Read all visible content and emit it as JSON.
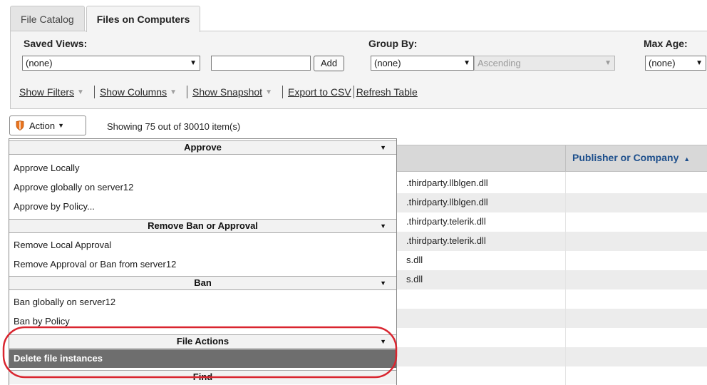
{
  "tabs": [
    {
      "label": "File Catalog",
      "active": false
    },
    {
      "label": "Files on Computers",
      "active": true
    }
  ],
  "filters": {
    "saved_views_label": "Saved Views:",
    "saved_views_value": "(none)",
    "view_name_value": "",
    "add_label": "Add",
    "group_by_label": "Group By:",
    "group_by_value": "(none)",
    "sort_order_value": "Ascending",
    "max_age_label": "Max Age:",
    "max_age_value": "(none)"
  },
  "links": {
    "show_filters": "Show Filters",
    "show_columns": "Show Columns",
    "show_snapshot": "Show Snapshot",
    "export_csv": "Export to CSV",
    "refresh_table": "Refresh Table"
  },
  "action_bar": {
    "action_label": "Action",
    "showing_text": "Showing 75 out of 30010 item(s)"
  },
  "table": {
    "publisher_header": "Publisher or Company",
    "rows": [
      ".thirdparty.llblgen.dll",
      ".thirdparty.llblgen.dll",
      ".thirdparty.telerik.dll",
      ".thirdparty.telerik.dll",
      "s.dll",
      "s.dll"
    ]
  },
  "menu": {
    "groups": {
      "approve": "Approve",
      "remove": "Remove Ban or Approval",
      "ban": "Ban",
      "file_actions": "File Actions",
      "find": "Find"
    },
    "items": {
      "approve_locally": "Approve Locally",
      "approve_global": "Approve globally on server12",
      "approve_policy": "Approve by Policy...",
      "remove_local": "Remove Local Approval",
      "remove_server": "Remove Approval or Ban from server12",
      "ban_global": "Ban globally on server12",
      "ban_policy": "Ban by Policy",
      "delete_instances": "Delete file instances"
    }
  },
  "colors": {
    "highlight_bg": "#6e6e6e",
    "annotation": "#d9252f",
    "header_link": "#1d4f8c",
    "shield": "#e8731d"
  },
  "icons": [
    "shield-icon",
    "dropdown-caret-icon",
    "sort-ascending-icon"
  ]
}
